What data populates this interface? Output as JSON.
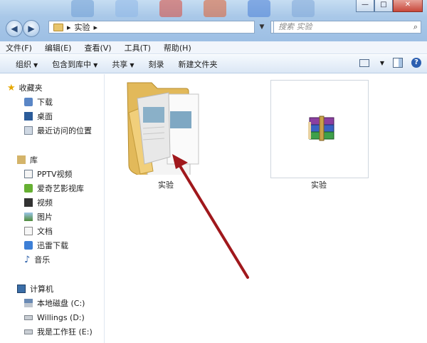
{
  "window": {
    "controls": [
      "—",
      "□",
      "✕"
    ]
  },
  "address": {
    "path_arrow_1": "▸",
    "path_folder": "实验",
    "path_arrow_2": "▸",
    "search_placeholder": "搜索 实验"
  },
  "menu": [
    "文件(F)",
    "编辑(E)",
    "查看(V)",
    "工具(T)",
    "帮助(H)"
  ],
  "toolbar": {
    "organize": "组织",
    "include_in_library": "包含到库中",
    "share": "共享",
    "burn": "刻录",
    "new_folder": "新建文件夹",
    "help": "?"
  },
  "sidebar": {
    "favorites": {
      "title": "收藏夹",
      "items": [
        "下载",
        "桌面",
        "最近访问的位置"
      ]
    },
    "libraries": {
      "title": "库",
      "items": [
        "PPTV视频",
        "爱奇艺影视库",
        "视频",
        "图片",
        "文档",
        "迅雷下载",
        "音乐"
      ]
    },
    "computer": {
      "title": "计算机",
      "items": [
        "本地磁盘 (C:)",
        "Willings (D:)",
        "我是工作狂 (E:)"
      ]
    }
  },
  "files": [
    {
      "name": "实验",
      "type": "folder-icon"
    },
    {
      "name": "实验",
      "type": "winrar-archive-icon"
    }
  ],
  "annotation": {
    "color": "#a0181c"
  }
}
